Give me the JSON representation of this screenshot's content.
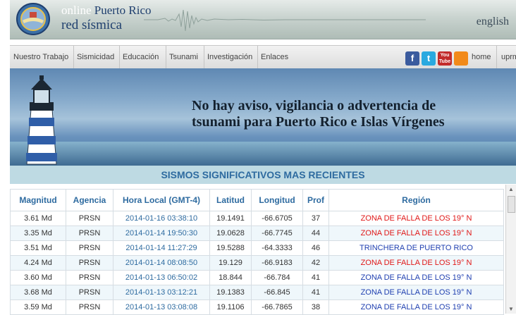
{
  "header": {
    "brand_line1_a": "online",
    "brand_line1_b": "Puerto Rico",
    "brand_line2": "red sísmica",
    "language": "english"
  },
  "nav": {
    "items": [
      "Nuestro Trabajo",
      "Sismicidad",
      "Educación",
      "Tsunami",
      "Investigación",
      "Enlaces"
    ],
    "home": "home",
    "uprm": "uprm.edu",
    "social": {
      "facebook": "f",
      "twitter": "t",
      "youtube": "You Tube",
      "rss": "rss"
    }
  },
  "banner": {
    "line1": "No hay aviso, vigilancia o advertencia de",
    "line2": "tsunami para Puerto Rico e Islas Vírgenes"
  },
  "table": {
    "title": "SISMOS SIGNIFICATIVOS MAS RECIENTES",
    "headers": [
      "Magnitud",
      "Agencia",
      "Hora Local (GMT-4)",
      "Latitud",
      "Longitud",
      "Prof",
      "Región"
    ],
    "rows": [
      {
        "mag": "3.61 Md",
        "ag": "PRSN",
        "hora": "2014-01-16 03:38:10",
        "lat": "19.1491",
        "lon": "-66.6705",
        "prof": "37",
        "reg": "ZONA DE FALLA DE LOS 19° N",
        "color": "red"
      },
      {
        "mag": "3.35 Md",
        "ag": "PRSN",
        "hora": "2014-01-14 19:50:30",
        "lat": "19.0628",
        "lon": "-66.7745",
        "prof": "44",
        "reg": "ZONA DE FALLA DE LOS 19° N",
        "color": "red"
      },
      {
        "mag": "3.51 Md",
        "ag": "PRSN",
        "hora": "2014-01-14 11:27:29",
        "lat": "19.5288",
        "lon": "-64.3333",
        "prof": "46",
        "reg": "TRINCHERA DE PUERTO RICO",
        "color": "blue"
      },
      {
        "mag": "4.24 Md",
        "ag": "PRSN",
        "hora": "2014-01-14 08:08:50",
        "lat": "19.129",
        "lon": "-66.9183",
        "prof": "42",
        "reg": "ZONA DE FALLA DE LOS 19° N",
        "color": "red"
      },
      {
        "mag": "3.60 Md",
        "ag": "PRSN",
        "hora": "2014-01-13 06:50:02",
        "lat": "18.844",
        "lon": "-66.784",
        "prof": "41",
        "reg": "ZONA DE FALLA DE LOS 19° N",
        "color": "blue"
      },
      {
        "mag": "3.68 Md",
        "ag": "PRSN",
        "hora": "2014-01-13 03:12:21",
        "lat": "19.1383",
        "lon": "-66.845",
        "prof": "41",
        "reg": "ZONA DE FALLA DE LOS 19° N",
        "color": "blue"
      },
      {
        "mag": "3.59 Md",
        "ag": "PRSN",
        "hora": "2014-01-13 03:08:08",
        "lat": "19.1106",
        "lon": "-66.7865",
        "prof": "38",
        "reg": "ZONA DE FALLA DE LOS 19° N",
        "color": "blue"
      }
    ]
  },
  "colors": {
    "accent": "#2e6ba0",
    "red_region": "#e01818",
    "blue_region": "#1f3fb0",
    "table_title_bg": "#bedae3"
  }
}
